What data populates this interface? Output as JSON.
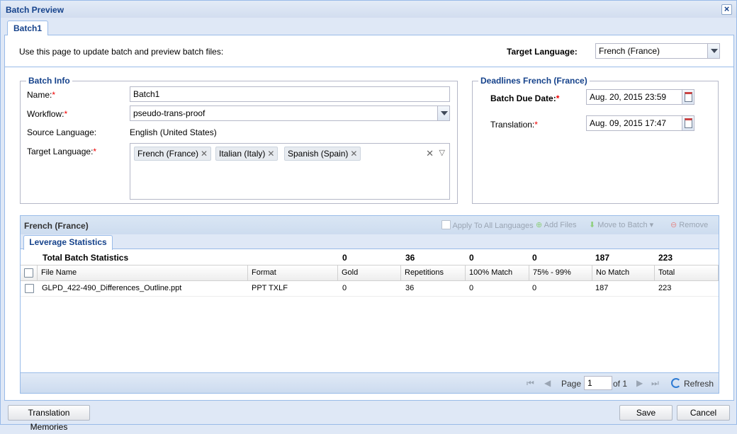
{
  "window": {
    "title": "Batch Preview",
    "close_icon": "close-icon"
  },
  "tabs": [
    {
      "label": "Batch1"
    }
  ],
  "intro_text": "Use this page to update batch and preview batch files:",
  "target_language_select": {
    "label": "Target Language:",
    "value": "French (France)"
  },
  "batch_info": {
    "legend": "Batch Info",
    "name_label": "Name:",
    "name_value": "Batch1",
    "workflow_label": "Workflow:",
    "workflow_value": "pseudo-trans-proof",
    "source_language_label": "Source Language:",
    "source_language_value": "English (United States)",
    "target_language_label": "Target Language:",
    "target_languages": [
      "French (France)",
      "Italian (Italy)",
      "Spanish (Spain)"
    ],
    "required_mark": "*"
  },
  "deadlines": {
    "legend": "Deadlines French (France)",
    "batch_due_label": "Batch Due Date:",
    "batch_due_value": "Aug. 20, 2015 23:59",
    "translation_label": "Translation:",
    "translation_value": "Aug. 09, 2015 17:47"
  },
  "grid_panel": {
    "title": "French (France)",
    "toolbar": {
      "apply_all": "Apply To All Languages",
      "add_files": "Add Files",
      "move_to_batch": "Move to Batch",
      "remove": "Remove"
    },
    "tab": "Leverage Statistics",
    "totals": {
      "label": "Total Batch Statistics",
      "gold": "0",
      "repetitions": "36",
      "match100": "0",
      "match75": "0",
      "no_match": "187",
      "total": "223"
    },
    "columns": {
      "file_name": "File Name",
      "format": "Format",
      "gold": "Gold",
      "repetitions": "Repetitions",
      "match100": "100% Match",
      "match75": "75% - 99%",
      "no_match": "No Match",
      "total": "Total"
    },
    "rows": [
      {
        "file_name": "GLPD_422-490_Differences_Outline.ppt",
        "format": "PPT TXLF",
        "gold": "0",
        "repetitions": "36",
        "match100": "0",
        "match75": "0",
        "no_match": "187",
        "total": "223"
      }
    ],
    "pager": {
      "page_label": "Page",
      "page_value": "1",
      "of_label": "of 1",
      "refresh": "Refresh"
    }
  },
  "footer": {
    "tm_button": "Translation Memories",
    "save": "Save",
    "cancel": "Cancel"
  }
}
